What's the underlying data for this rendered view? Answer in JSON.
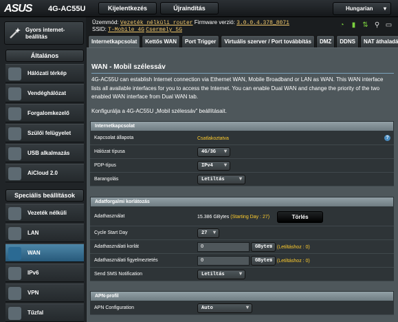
{
  "header": {
    "brand": "ASUS",
    "model": "4G-AC55U",
    "logout_label": "Kijelentkezés",
    "reboot_label": "Újraindítás",
    "language": "Hungarian"
  },
  "info": {
    "mode_label": "Üzemmód:",
    "mode_value": "Vezeték nélküli router",
    "firmware_label": "Firmware verzió:",
    "firmware_value": "3.0.0.4.378_8071",
    "ssid_label": "SSID:",
    "ssid_1": "T-Mobile 4G",
    "ssid_2": "Csermely 5G"
  },
  "sidebar": {
    "quick_setup": "Gyors internet-beállítás",
    "general_title": "Általános",
    "general_items": [
      {
        "label": "Hálózati térkép",
        "icon": "network-map-icon"
      },
      {
        "label": "Vendéghálózat",
        "icon": "guest-network-icon"
      },
      {
        "label": "Forgalomkezelő",
        "icon": "traffic-manager-icon"
      },
      {
        "label": "Szülői felügyelet",
        "icon": "parental-control-icon"
      },
      {
        "label": "USB alkalmazás",
        "icon": "usb-icon"
      },
      {
        "label": "AiCloud 2.0",
        "icon": "cloud-icon"
      }
    ],
    "advanced_title": "Speciális beállítások",
    "advanced_items": [
      {
        "label": "Vezeték nélküli",
        "icon": "wireless-icon"
      },
      {
        "label": "LAN",
        "icon": "lan-icon"
      },
      {
        "label": "WAN",
        "icon": "wan-globe-icon"
      },
      {
        "label": "IPv6",
        "icon": "ipv6-icon"
      },
      {
        "label": "VPN",
        "icon": "vpn-icon"
      },
      {
        "label": "Tűzfal",
        "icon": "firewall-icon"
      }
    ]
  },
  "tabs": [
    "Internetkapcsolat",
    "Kettős WAN",
    "Port Trigger",
    "Virtuális szerver / Port továbbítás",
    "DMZ",
    "DDNS",
    "NAT áthaladás"
  ],
  "main": {
    "title": "WAN - Mobil szélessáv",
    "description": "4G-AC55U can establish Internet connection via Ethernet WAN, Mobile Broadband or LAN as WAN. This WAN interface lists all available interfaces for you to access the Internet. You can enable Dual WAN and change the priority of the two enabled WAN interface from Dual WAN tab.",
    "config_text": "Konfigurálja a 4G-AC55U „Mobil szélessáv” beállításait."
  },
  "internet_section": {
    "title": "Internetkapcsolat",
    "status_label": "Kapcsolat állapota",
    "status_value": "Csatlakoztatva",
    "network_type_label": "Hálózat típusa",
    "network_type_value": "4G/3G",
    "pdp_label": "PDP-típus",
    "pdp_value": "IPv4",
    "roaming_label": "Barangolás",
    "roaming_value": "Letiltás"
  },
  "traffic_section": {
    "title": "Adatforgalmi korlátozás",
    "usage_label": "Adathasználat",
    "usage_value": "15.386 GBytes",
    "usage_note": "(Starting Day : 27)",
    "delete_label": "Törlés",
    "cycle_label": "Cycle Start Day",
    "cycle_value": "27",
    "limit_label": "Adathasználati korlát",
    "limit_value": "0",
    "limit_unit": "GBytes",
    "limit_note": "(Letiltáshoz : 0)",
    "warning_label": "Adathasználati figyelmeztetés",
    "warning_value": "0",
    "warning_unit": "GBytes",
    "warning_note": "(Letiltáshoz : 0)",
    "sms_label": "Send SMS Notification",
    "sms_value": "Letiltás"
  },
  "apn_section": {
    "title": "APN-profil",
    "apn_label": "APN Configuration",
    "apn_value": "Auto"
  },
  "colors": {
    "accent": "#ffcc2d",
    "active_nav": "#27597a"
  }
}
